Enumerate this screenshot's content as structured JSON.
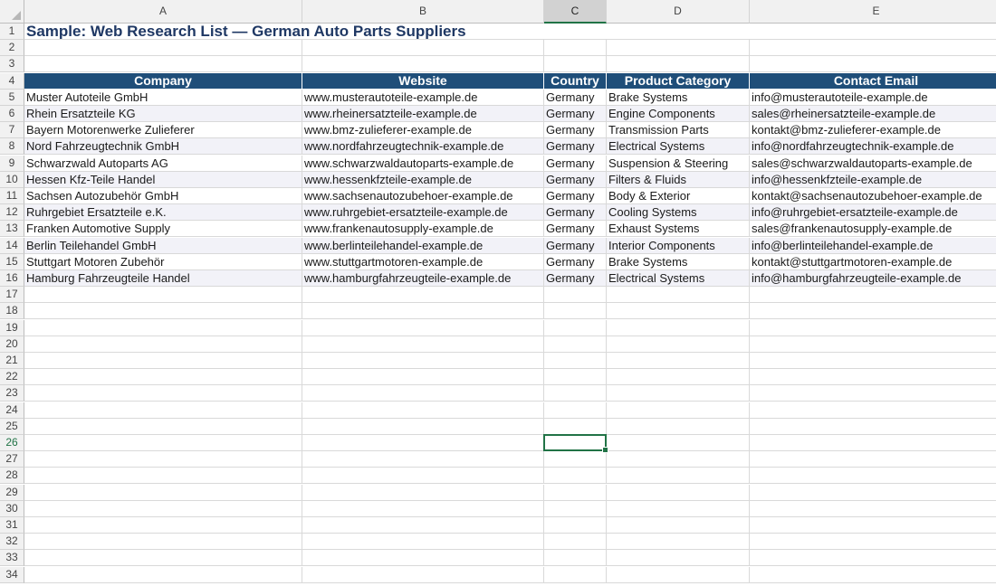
{
  "sheet": {
    "columns": [
      "A",
      "B",
      "C",
      "D",
      "E"
    ],
    "active_column": "C",
    "active_row": "26",
    "title": "Sample: Web Research List — German Auto Parts Suppliers",
    "headers": [
      "Company",
      "Website",
      "Country",
      "Product Category",
      "Contact Email"
    ],
    "rows": [
      [
        "Muster Autoteile GmbH",
        "www.musterautoteile-example.de",
        "Germany",
        "Brake Systems",
        "info@musterautoteile-example.de"
      ],
      [
        "Rhein Ersatzteile KG",
        "www.rheinersatzteile-example.de",
        "Germany",
        "Engine Components",
        "sales@rheinersatzteile-example.de"
      ],
      [
        "Bayern Motorenwerke Zulieferer",
        "www.bmz-zulieferer-example.de",
        "Germany",
        "Transmission Parts",
        "kontakt@bmz-zulieferer-example.de"
      ],
      [
        "Nord Fahrzeugtechnik GmbH",
        "www.nordfahrzeugtechnik-example.de",
        "Germany",
        "Electrical Systems",
        "info@nordfahrzeugtechnik-example.de"
      ],
      [
        "Schwarzwald Autoparts AG",
        "www.schwarzwaldautoparts-example.de",
        "Germany",
        "Suspension & Steering",
        "sales@schwarzwaldautoparts-example.de"
      ],
      [
        "Hessen Kfz-Teile Handel",
        "www.hessenkfzteile-example.de",
        "Germany",
        "Filters & Fluids",
        "info@hessenkfzteile-example.de"
      ],
      [
        "Sachsen Autozubehör GmbH",
        "www.sachsenautozubehoer-example.de",
        "Germany",
        "Body & Exterior",
        "kontakt@sachsenautozubehoer-example.de"
      ],
      [
        "Ruhrgebiet Ersatzteile e.K.",
        "www.ruhrgebiet-ersatzteile-example.de",
        "Germany",
        "Cooling Systems",
        "info@ruhrgebiet-ersatzteile-example.de"
      ],
      [
        "Franken Automotive Supply",
        "www.frankenautosupply-example.de",
        "Germany",
        "Exhaust Systems",
        "sales@frankenautosupply-example.de"
      ],
      [
        "Berlin Teilehandel GmbH",
        "www.berlinteilehandel-example.de",
        "Germany",
        "Interior Components",
        "info@berlinteilehandel-example.de"
      ],
      [
        "Stuttgart Motoren Zubehör",
        "www.stuttgartmotoren-example.de",
        "Germany",
        "Brake Systems",
        "kontakt@stuttgartmotoren-example.de"
      ],
      [
        "Hamburg Fahrzeugteile Handel",
        "www.hamburgfahrzeugteile-example.de",
        "Germany",
        "Electrical Systems",
        "info@hamburgfahrzeugteile-example.de"
      ]
    ],
    "row_numbers": [
      "1",
      "2",
      "3",
      "4",
      "5",
      "6",
      "7",
      "8",
      "9",
      "10",
      "11",
      "12",
      "13",
      "14",
      "15",
      "16",
      "17",
      "18",
      "19",
      "20",
      "21",
      "22",
      "23",
      "24",
      "25",
      "26",
      "27",
      "28",
      "29",
      "30",
      "31",
      "32",
      "33",
      "34"
    ]
  }
}
